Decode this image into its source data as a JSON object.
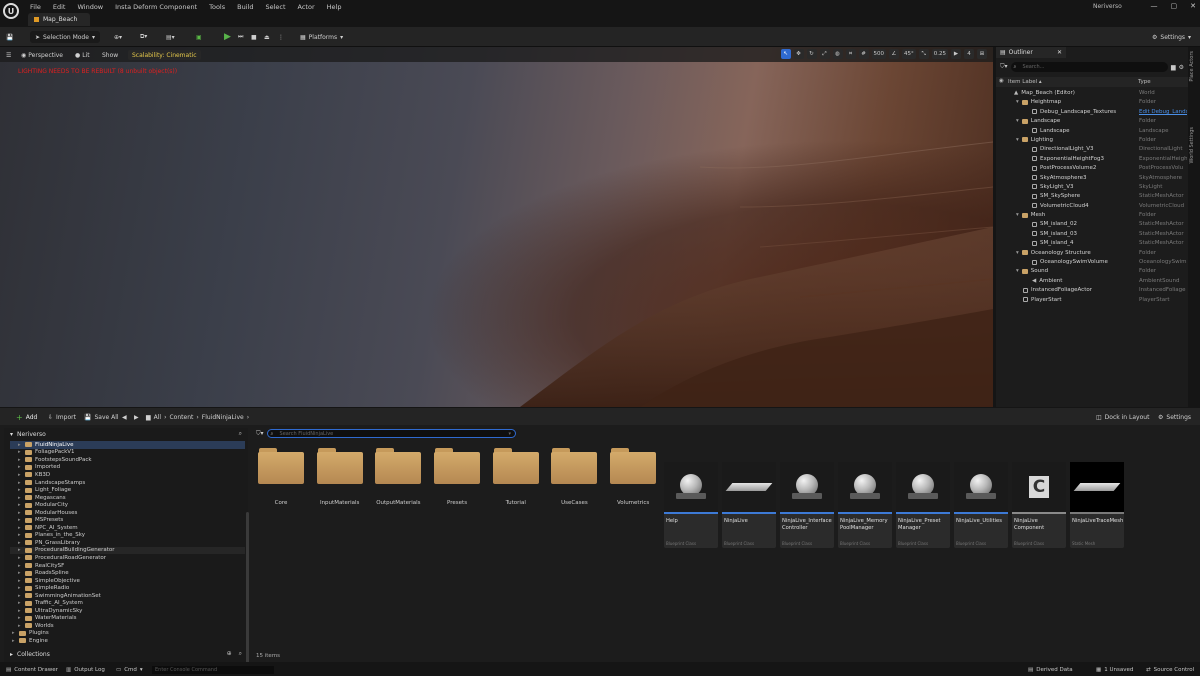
{
  "menubar": {
    "logo": "U",
    "items": [
      "File",
      "Edit",
      "Window",
      "Insta Deform Component",
      "Tools",
      "Build",
      "Select",
      "Actor",
      "Help"
    ],
    "map_tab": "Map_Beach",
    "project": "Neriverso",
    "win_min": "—",
    "win_max": "▢",
    "win_close": "✕"
  },
  "toolbar": {
    "selection_mode": "Selection Mode",
    "platforms": "Platforms",
    "settings": "Settings"
  },
  "viewport": {
    "perspective": "Perspective",
    "lit": "Lit",
    "show": "Show",
    "scalability": "Scalability: Cinematic",
    "error_text": "LIGHTING NEEDS TO BE REBUILT (8 unbuilt object(s))",
    "grid_value": "500",
    "angle_value": "45°",
    "scale_value": "0.25",
    "camera_speed": "4"
  },
  "outliner": {
    "tab": "Outliner",
    "search_placeholder": "Search...",
    "col_label": "Item Label ▴",
    "col_type": "Type",
    "rows": [
      {
        "label": "Map_Beach (Editor)",
        "type": "World",
        "indent": 0,
        "icon": "world"
      },
      {
        "label": "Heightmap",
        "type": "Folder",
        "indent": 1,
        "icon": "folder"
      },
      {
        "label": "Debug_Landscape_Textures",
        "type": "Edit Debug_Lands",
        "indent": 2,
        "icon": "actor",
        "link": true
      },
      {
        "label": "Landscape",
        "type": "Folder",
        "indent": 1,
        "icon": "folder"
      },
      {
        "label": "Landscape",
        "type": "Landscape",
        "indent": 2,
        "icon": "actor"
      },
      {
        "label": "Lighting",
        "type": "Folder",
        "indent": 1,
        "icon": "folder"
      },
      {
        "label": "DirectionalLight_V3",
        "type": "DirectionalLight",
        "indent": 2,
        "icon": "actor"
      },
      {
        "label": "ExponentialHeightFog3",
        "type": "ExponentialHeight",
        "indent": 2,
        "icon": "actor"
      },
      {
        "label": "PostProcessVolume2",
        "type": "PostProcessVolu",
        "indent": 2,
        "icon": "actor"
      },
      {
        "label": "SkyAtmosphere3",
        "type": "SkyAtmosphere",
        "indent": 2,
        "icon": "actor"
      },
      {
        "label": "SkyLight_V3",
        "type": "SkyLight",
        "indent": 2,
        "icon": "actor"
      },
      {
        "label": "SM_SkySphere",
        "type": "StaticMeshActor",
        "indent": 2,
        "icon": "actor"
      },
      {
        "label": "VolumetricCloud4",
        "type": "VolumetricCloud",
        "indent": 2,
        "icon": "actor"
      },
      {
        "label": "Mesh",
        "type": "Folder",
        "indent": 1,
        "icon": "folder"
      },
      {
        "label": "SM_island_02",
        "type": "StaticMeshActor",
        "indent": 2,
        "icon": "actor"
      },
      {
        "label": "SM_island_03",
        "type": "StaticMeshActor",
        "indent": 2,
        "icon": "actor"
      },
      {
        "label": "SM_island_4",
        "type": "StaticMeshActor",
        "indent": 2,
        "icon": "actor"
      },
      {
        "label": "Oceanology Structure",
        "type": "Folder",
        "indent": 1,
        "icon": "folder"
      },
      {
        "label": "OceanologySwimVolume",
        "type": "OceanologySwim",
        "indent": 2,
        "icon": "actor"
      },
      {
        "label": "Sound",
        "type": "Folder",
        "indent": 1,
        "icon": "folder"
      },
      {
        "label": "Ambient",
        "type": "AmbientSound",
        "indent": 2,
        "icon": "sound"
      },
      {
        "label": "InstancedFoliageActor",
        "type": "InstancedFoliage",
        "indent": 1,
        "icon": "actor"
      },
      {
        "label": "PlayerStart",
        "type": "PlayerStart",
        "indent": 1,
        "icon": "actor"
      }
    ],
    "side_tabs": [
      "Place Actors",
      "World Settings"
    ]
  },
  "content_browser": {
    "add": "Add",
    "import": "Import",
    "save_all": "Save All",
    "breadcrumb": [
      "All",
      "Content",
      "FluidNinjaLive"
    ],
    "dock": "Dock in Layout",
    "settings": "Settings",
    "root": "Neriverso",
    "search_placeholder": "Search FluidNinjaLive",
    "tree": [
      {
        "label": "FluidNinjaLive",
        "selected": true
      },
      {
        "label": "FoliagePackV1"
      },
      {
        "label": "FootstepsSoundPack"
      },
      {
        "label": "Imported"
      },
      {
        "label": "KB3D"
      },
      {
        "label": "LandscapeStamps"
      },
      {
        "label": "Light_Foliage"
      },
      {
        "label": "Megascans"
      },
      {
        "label": "ModularCity"
      },
      {
        "label": "ModularHouses"
      },
      {
        "label": "MSPresets"
      },
      {
        "label": "NPC_AI_System"
      },
      {
        "label": "Planes_in_the_Sky"
      },
      {
        "label": "PN_GrassLibrary"
      },
      {
        "label": "ProceduralBuildingGenerator",
        "hover": true
      },
      {
        "label": "ProceduralRoadGenerator"
      },
      {
        "label": "RealCitySF"
      },
      {
        "label": "RoadsSpline"
      },
      {
        "label": "SimpleObjective"
      },
      {
        "label": "SimpleRadio"
      },
      {
        "label": "SwimmingAnimationSet"
      },
      {
        "label": "Traffic_AI_System"
      },
      {
        "label": "UltraDynamicSky"
      },
      {
        "label": "WaterMaterials"
      },
      {
        "label": "Worlds"
      },
      {
        "label": "Plugins",
        "top": true
      },
      {
        "label": "Engine",
        "top": true
      }
    ],
    "collections": "Collections",
    "folders": [
      "Core",
      "InputMaterials",
      "OutputMaterials",
      "Presets",
      "Tutorial",
      "UseCases",
      "Volumetrics"
    ],
    "assets": [
      {
        "name": "Help",
        "type": "Blueprint Class",
        "thumb": "sphere"
      },
      {
        "name": "NinjaLive",
        "type": "Blueprint Class",
        "thumb": "plane"
      },
      {
        "name": "NinjaLive_Interface Controller",
        "type": "Blueprint Class",
        "thumb": "sphere"
      },
      {
        "name": "NinjaLive_Memory PoolManager",
        "type": "Blueprint Class",
        "thumb": "sphere"
      },
      {
        "name": "NinjaLive_Preset Manager",
        "type": "Blueprint Class",
        "thumb": "sphere"
      },
      {
        "name": "NinjaLive_Utilities",
        "type": "Blueprint Class",
        "thumb": "sphere"
      },
      {
        "name": "NinjaLive Component",
        "type": "Blueprint Class",
        "thumb": "component"
      },
      {
        "name": "NinjaLiveTraceMesh",
        "type": "Static Mesh",
        "thumb": "mesh"
      }
    ],
    "item_count": "15 items"
  },
  "statusbar": {
    "content_drawer": "Content Drawer",
    "output_log": "Output Log",
    "cmd": "Cmd",
    "console_placeholder": "Enter Console Command",
    "derived_data": "Derived Data",
    "unsaved": "1 Unsaved",
    "source_control": "Source Control"
  }
}
